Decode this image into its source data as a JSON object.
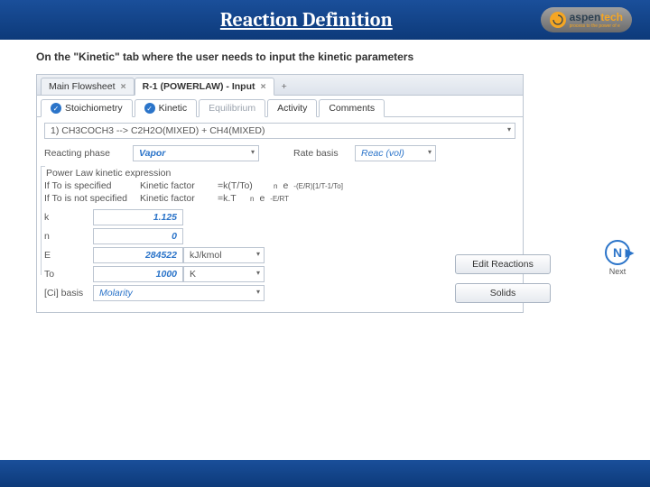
{
  "slide": {
    "title": "Reaction Definition"
  },
  "logo": {
    "brand": "aspen",
    "suffix": "tech",
    "tagline": "process to the power of e"
  },
  "instruction": "On the \"Kinetic\" tab where the user needs to input the kinetic parameters",
  "doc_tabs": {
    "main": "Main Flowsheet",
    "active": "R-1 (POWERLAW) - Input"
  },
  "subtabs": {
    "stoich": "Stoichiometry",
    "kinetic": "Kinetic",
    "equilibrium": "Equilibrium",
    "activity": "Activity",
    "comments": "Comments"
  },
  "rxn": "1) CH3COCH3  -->  C2H2O(MIXED) + CH4(MIXED)",
  "labels": {
    "reacting_phase": "Reacting phase",
    "rate_basis": "Rate basis",
    "group": "Power Law kinetic expression",
    "if_to_spec": "If To is specified",
    "if_to_notspec": "If To is not specified",
    "kinetic_factor": "Kinetic factor",
    "eq1_prefix": "=k(T/To)",
    "eq1_n": "n",
    "eq1_e": "e",
    "eq1_exp": "-(E/R)[1/T-1/To]",
    "eq2_prefix": "=k.T",
    "eq2_n": "n",
    "eq2_e": "e",
    "eq2_exp": "-E/RT"
  },
  "values": {
    "phase": "Vapor",
    "rate_basis": "Reac (vol)"
  },
  "params": {
    "k_label": "k",
    "k_val": "1.125",
    "n_label": "n",
    "n_val": "0",
    "E_label": "E",
    "E_val": "284522",
    "E_unit": "kJ/kmol",
    "To_label": "To",
    "To_val": "1000",
    "To_unit": "K",
    "Ci_label": "[Ci] basis",
    "Ci_val": "Molarity"
  },
  "buttons": {
    "edit": "Edit Reactions",
    "solids": "Solids",
    "next": "N",
    "next_label": "Next"
  }
}
